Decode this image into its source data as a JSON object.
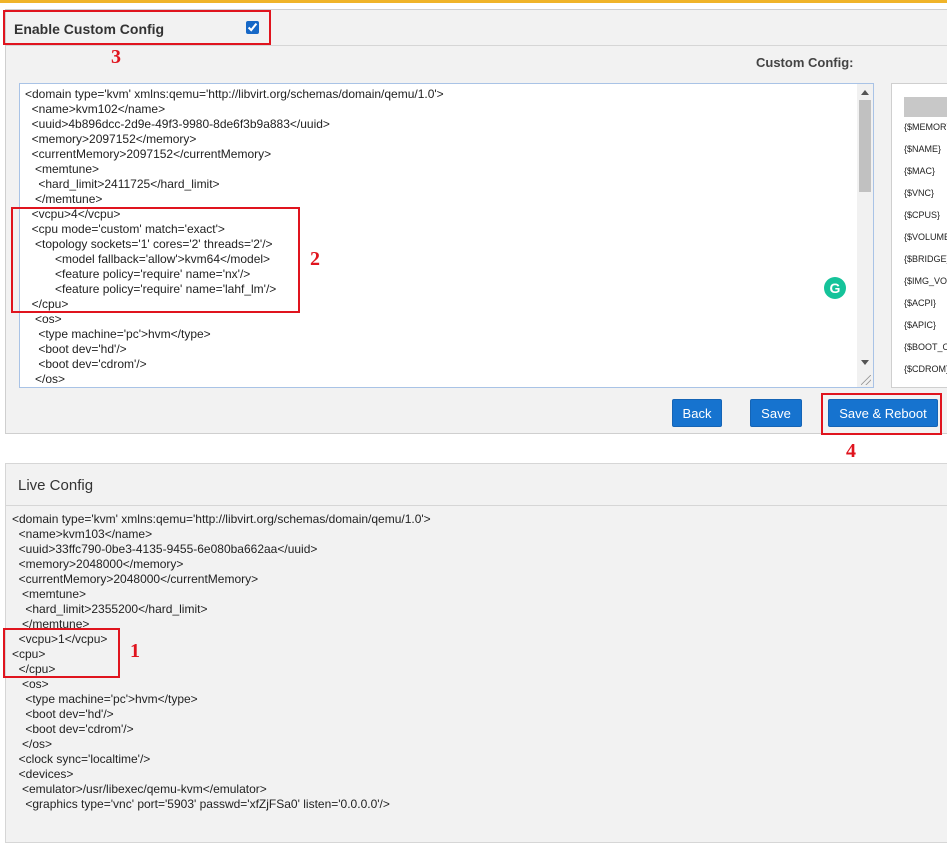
{
  "header": {
    "enable_label": "Enable Custom Config",
    "enable_checked": true,
    "custom_config_label": "Custom Config:"
  },
  "custom_editor": {
    "lines": [
      "<domain type='kvm' xmlns:qemu='http://libvirt.org/schemas/domain/qemu/1.0'>",
      "  <name>kvm102</name>",
      "  <uuid>4b896dcc-2d9e-49f3-9980-8de6f3b9a883</uuid>",
      "  <memory>2097152</memory>",
      "  <currentMemory>2097152</currentMemory>",
      "   <memtune>",
      "    <hard_limit>2411725</hard_limit>",
      "   </memtune>",
      "  <vcpu>4</vcpu>",
      "  <cpu mode='custom' match='exact'>",
      "   <topology sockets='1' cores='2' threads='2'/>",
      "         <model fallback='allow'>kvm64</model>",
      "         <feature policy='require' name='nx'/>",
      "         <feature policy='require' name='lahf_lm'/>",
      "  </cpu>",
      "   <os>",
      "    <type machine='pc'>hvm</type>",
      "    <boot dev='hd'/>",
      "    <boot dev='cdrom'/>",
      "   </os>"
    ]
  },
  "variables": [
    "{$MEMORY}",
    "{$NAME}",
    "{$MAC}",
    "{$VNC}",
    "{$CPUS}",
    "{$VOLUME}",
    "{$BRIDGE}",
    "{$IMG_VOL}",
    "{$ACPI}",
    "{$APIC}",
    "{$BOOT_ORDER}",
    "{$CDROM}"
  ],
  "buttons": {
    "back": "Back",
    "save": "Save",
    "save_reboot": "Save & Reboot"
  },
  "live": {
    "title": "Live Config",
    "lines": [
      "<domain type='kvm' xmlns:qemu='http://libvirt.org/schemas/domain/qemu/1.0'>",
      "  <name>kvm103</name>",
      "  <uuid>33ffc790-0be3-4135-9455-6e080ba662aa</uuid>",
      "  <memory>2048000</memory>",
      "  <currentMemory>2048000</currentMemory>",
      "   <memtune>",
      "    <hard_limit>2355200</hard_limit>",
      "   </memtune>",
      "  <vcpu>1</vcpu>",
      "<cpu>",
      "  </cpu>",
      "   <os>",
      "    <type machine='pc'>hvm</type>",
      "    <boot dev='hd'/>",
      "    <boot dev='cdrom'/>",
      "   </os>",
      "  <clock sync='localtime'/>",
      "  <devices>",
      "   <emulator>/usr/libexec/qemu-kvm</emulator>",
      "    <graphics type='vnc' port='5903' passwd='xfZjFSa0' listen='0.0.0.0'/>"
    ]
  },
  "annotations": {
    "n1": "1",
    "n2": "2",
    "n3": "3",
    "n4": "4"
  },
  "colors": {
    "annotation_red": "#e0141e",
    "button_blue": "#1673cf",
    "top_accent": "#f0b429"
  }
}
